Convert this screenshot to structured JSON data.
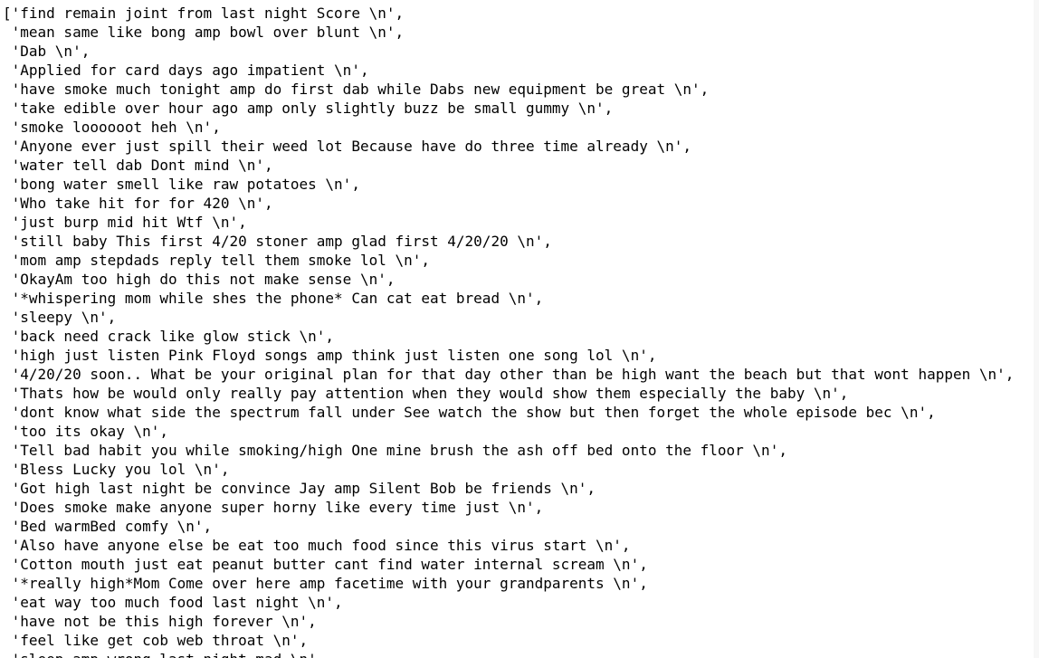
{
  "output": {
    "lines": [
      "['find remain joint from last night Score \\n',",
      " 'mean same like bong amp bowl over blunt \\n',",
      " 'Dab \\n',",
      " 'Applied for card days ago impatient \\n',",
      " 'have smoke much tonight amp do first dab while Dabs new equipment be great \\n',",
      " 'take edible over hour ago amp only slightly buzz be small gummy \\n',",
      " 'smoke loooooot heh \\n',",
      " 'Anyone ever just spill their weed lot Because have do three time already \\n',",
      " 'water tell dab Dont mind \\n',",
      " 'bong water smell like raw potatoes \\n',",
      " 'Who take hit for for 420 \\n',",
      " 'just burp mid hit Wtf \\n',",
      " 'still baby This first 4/20 stoner amp glad first 4/20/20 \\n',",
      " 'mom amp stepdads reply tell them smoke lol \\n',",
      " 'OkayAm too high do this not make sense \\n',",
      " '*whispering mom while shes the phone* Can cat eat bread \\n',",
      " 'sleepy \\n',",
      " 'back need crack like glow stick \\n',",
      " 'high just listen Pink Floyd songs amp think just listen one song lol \\n',",
      " '4/20/20 soon.. What be your original plan for that day other than be high want the beach but that wont happen \\n',",
      " 'Thats how be would only really pay attention when they would show them especially the baby \\n',",
      " 'dont know what side the spectrum fall under See watch the show but then forget the whole episode bec \\n',",
      " 'too its okay \\n',",
      " 'Tell bad habit you while smoking/high One mine brush the ash off bed onto the floor \\n',",
      " 'Bless Lucky you lol \\n',",
      " 'Got high last night be convince Jay amp Silent Bob be friends \\n',",
      " 'Does smoke make anyone super horny like every time just \\n',",
      " 'Bed warmBed comfy \\n',",
      " 'Also have anyone else be eat too much food since this virus start \\n',",
      " 'Cotton mouth just eat peanut butter cant find water internal scream \\n',",
      " '*really high*Mom Come over here amp facetime with your grandparents \\n',",
      " 'eat way too much food last night \\n',",
      " 'have not be this high forever \\n',",
      " 'feel like get cob web throat \\n',",
      " 'sleep amp wrong last night mad \\n',"
    ]
  }
}
